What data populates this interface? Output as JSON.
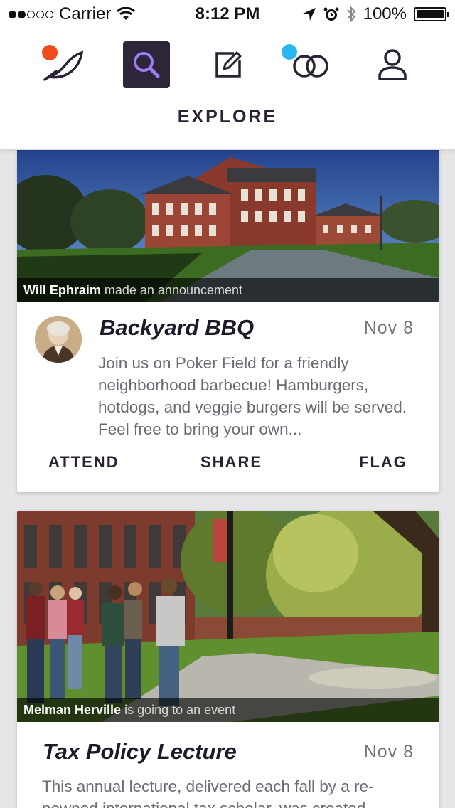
{
  "status_bar": {
    "carrier": "Carrier",
    "time": "8:12 PM",
    "battery": "100%"
  },
  "nav": {
    "active_label": "EXPLORE",
    "items": [
      {
        "name": "feather-icon",
        "badge_color": "#f04a1e"
      },
      {
        "name": "search-icon",
        "active": true
      },
      {
        "name": "compose-icon"
      },
      {
        "name": "circles-icon",
        "badge_color": "#29b6f1"
      },
      {
        "name": "profile-icon"
      }
    ]
  },
  "colors": {
    "accent": "#2d2538",
    "highlight": "#9d7cf5",
    "text_dark": "#2a2234",
    "text_muted": "#6d6873"
  },
  "cards": [
    {
      "user": "Will Ephraim",
      "activity": "made an announcement",
      "title": "Backyard BBQ",
      "date": "Nov 8",
      "description": "Join us on Poker Field for a friendly neighborhood barbecue! Hamburgers, hotdogs, and veggie burgers will be served. Feel free to bring your own...",
      "actions": [
        "ATTEND",
        "SHARE",
        "FLAG"
      ]
    },
    {
      "user": "Melman Herville",
      "activity": "is going to an event",
      "title": "Tax Policy Lecture",
      "date": "Nov 8",
      "description": "This annual lecture, delivered each fall by a re-nowned international tax scholar, was created"
    }
  ]
}
